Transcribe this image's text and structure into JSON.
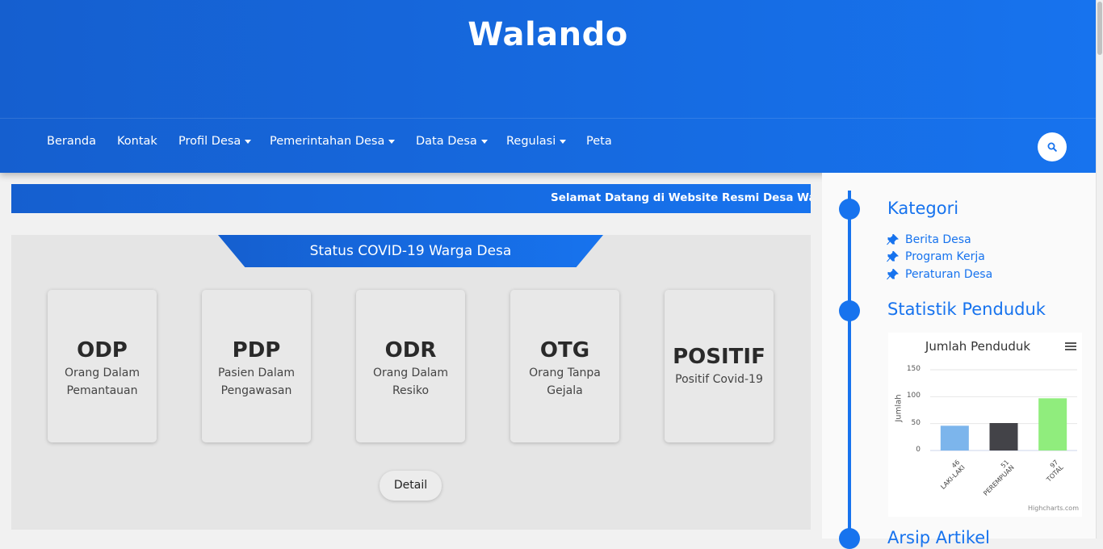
{
  "site": {
    "title": "Walando"
  },
  "nav": {
    "items": [
      {
        "label": "Beranda",
        "dropdown": false
      },
      {
        "label": "Kontak",
        "dropdown": false
      },
      {
        "label": "Profil Desa",
        "dropdown": true
      },
      {
        "label": "Pemerintahan Desa",
        "dropdown": true
      },
      {
        "label": "Data Desa",
        "dropdown": true
      },
      {
        "label": "Regulasi",
        "dropdown": true
      },
      {
        "label": "Peta",
        "dropdown": false
      }
    ],
    "search_icon": "search-icon"
  },
  "marquee": {
    "text": "Selamat Datang di Website Resmi Desa Wal"
  },
  "covid": {
    "title": "Status COVID-19 Warga Desa",
    "cards": [
      {
        "title": "ODP",
        "desc": "Orang Dalam Pemantauan"
      },
      {
        "title": "PDP",
        "desc": "Pasien Dalam Pengawasan"
      },
      {
        "title": "ODR",
        "desc": "Orang Dalam Resiko"
      },
      {
        "title": "OTG",
        "desc": "Orang Tanpa Gejala"
      },
      {
        "title": "POSITIF",
        "desc": "Positif Covid-19"
      }
    ],
    "detail_label": "Detail"
  },
  "sidebar": {
    "kategori_title": "Kategori",
    "kategori_items": [
      "Berita Desa",
      "Program Kerja",
      "Peraturan Desa"
    ],
    "statistik_title": "Statistik Penduduk",
    "next_title": "Arsip Artikel"
  },
  "colors": {
    "primary": "#1773ee",
    "primary_dark": "#155fcf"
  },
  "chart_data": {
    "type": "bar",
    "title": "Jumlah Penduduk",
    "ylabel": "Jumlah",
    "ylim": [
      0,
      150
    ],
    "yticks": [
      0,
      50,
      100,
      150
    ],
    "categories": [
      "LAKI-LAKI",
      "PEREMPUAN",
      "TOTAL"
    ],
    "values": [
      46,
      51,
      97
    ],
    "category_labels": [
      "46 LAKI-LAKI",
      "51 PEREMPUAN",
      "97 TOTAL"
    ],
    "value_labels": [
      "46",
      "51",
      "97"
    ],
    "bar_colors": [
      "#7cb5ec",
      "#434348",
      "#90ed7d"
    ],
    "credit": "Highcharts.com",
    "grid": true,
    "legend": "none"
  }
}
